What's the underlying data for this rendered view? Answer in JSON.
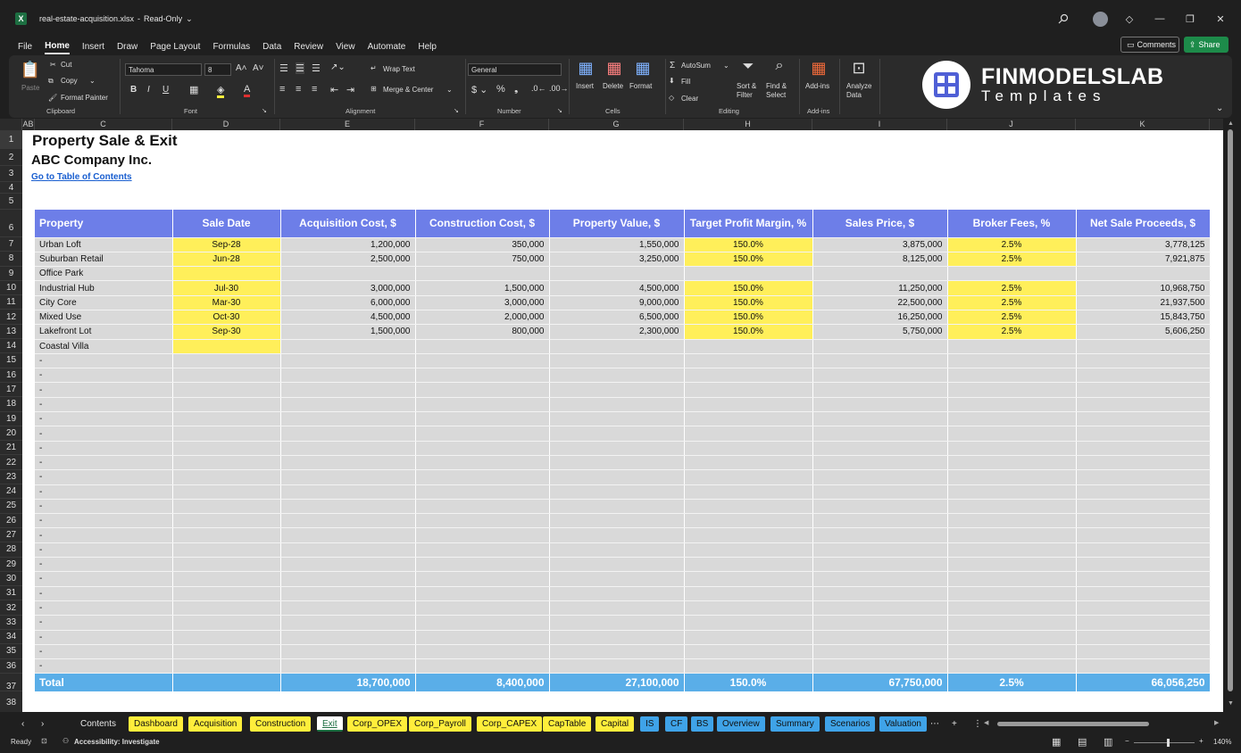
{
  "window": {
    "filename": "real-estate-acquisition.xlsx",
    "mode": "Read-Only"
  },
  "menu": [
    "File",
    "Home",
    "Insert",
    "Draw",
    "Page Layout",
    "Formulas",
    "Data",
    "Review",
    "View",
    "Automate",
    "Help"
  ],
  "topright": {
    "comments": "Comments",
    "share": "Share"
  },
  "ribbon": {
    "paste": "Paste",
    "cut": "Cut",
    "copy": "Copy",
    "format_painter": "Format Painter",
    "clipboard": "Clipboard",
    "font_name": "Tahoma",
    "font_size": "8",
    "font": "Font",
    "wrap_text": "Wrap Text",
    "merge_center": "Merge & Center",
    "alignment": "Alignment",
    "number_format": "General",
    "number": "Number",
    "insert": "Insert",
    "delete": "Delete",
    "format": "Format",
    "cells": "Cells",
    "autosum": "AutoSum",
    "fill": "Fill",
    "clear": "Clear",
    "sort_filter": "Sort & Filter",
    "find_select": "Find & Select",
    "editing": "Editing",
    "addins": "Add-ins",
    "addins_group": "Add-ins",
    "analyze_data": "Analyze Data"
  },
  "logo": {
    "line1": "FINMODELSLAB",
    "line2": "Templates"
  },
  "columns": [
    "AB",
    "C",
    "D",
    "E",
    "F",
    "G",
    "H",
    "I",
    "J",
    "K"
  ],
  "sheet": {
    "title": "Property Sale & Exit",
    "company": "ABC Company Inc.",
    "link": "Go to Table of Contents",
    "headers": [
      "Property",
      "Sale Date",
      "Acquisition Cost, $",
      "Construction Cost, $",
      "Property Value, $",
      "Target Profit Margin, %",
      "Sales Price, $",
      "Broker Fees, %",
      "Net Sale Proceeds, $"
    ],
    "rows": [
      [
        "Urban Loft",
        "Sep-28",
        "1,200,000",
        "350,000",
        "1,550,000",
        "150.0%",
        "3,875,000",
        "2.5%",
        "3,778,125"
      ],
      [
        "Suburban Retail",
        "Jun-28",
        "2,500,000",
        "750,000",
        "3,250,000",
        "150.0%",
        "8,125,000",
        "2.5%",
        "7,921,875"
      ],
      [
        "Office Park",
        "",
        "",
        "",
        "",
        "",
        "",
        "",
        ""
      ],
      [
        "Industrial Hub",
        "Jul-30",
        "3,000,000",
        "1,500,000",
        "4,500,000",
        "150.0%",
        "11,250,000",
        "2.5%",
        "10,968,750"
      ],
      [
        "City Core",
        "Mar-30",
        "6,000,000",
        "3,000,000",
        "9,000,000",
        "150.0%",
        "22,500,000",
        "2.5%",
        "21,937,500"
      ],
      [
        "Mixed Use",
        "Oct-30",
        "4,500,000",
        "2,000,000",
        "6,500,000",
        "150.0%",
        "16,250,000",
        "2.5%",
        "15,843,750"
      ],
      [
        "Lakefront Lot",
        "Sep-30",
        "1,500,000",
        "800,000",
        "2,300,000",
        "150.0%",
        "5,750,000",
        "2.5%",
        "5,606,250"
      ],
      [
        "Coastal Villa",
        "",
        "",
        "",
        "",
        "",
        "",
        "",
        ""
      ]
    ],
    "dash_rows": 22,
    "dash": "-",
    "total": [
      "Total",
      "",
      "18,700,000",
      "8,400,000",
      "27,100,000",
      "150.0%",
      "67,750,000",
      "2.5%",
      "66,056,250"
    ]
  },
  "row_numbers": [
    "1",
    "2",
    "3",
    "4",
    "5",
    "6",
    "7",
    "8",
    "9",
    "10",
    "11",
    "12",
    "13",
    "14",
    "15",
    "16",
    "17",
    "18",
    "19",
    "20",
    "21",
    "22",
    "23",
    "24",
    "25",
    "26",
    "27",
    "28",
    "29",
    "30",
    "31",
    "32",
    "33",
    "34",
    "35",
    "36",
    "37",
    "38"
  ],
  "sheet_tabs": [
    "Contents",
    "Dashboard",
    "Acquisition",
    "Construction",
    "Exit",
    "Corp_OPEX",
    "Corp_Payroll",
    "Corp_CAPEX",
    "CapTable",
    "Capital",
    "IS",
    "CF",
    "BS",
    "Overview",
    "Summary",
    "Scenarios",
    "Valuation"
  ],
  "statusbar": {
    "ready": "Ready",
    "accessibility": "Accessibility: Investigate",
    "zoom": "140%"
  }
}
